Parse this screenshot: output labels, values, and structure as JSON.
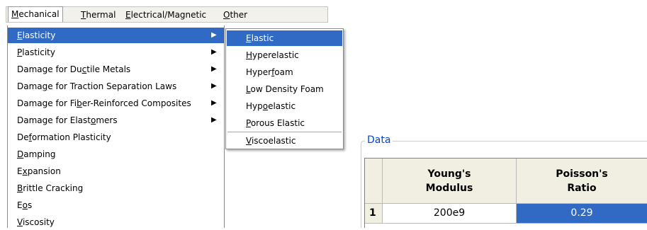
{
  "menubar": {
    "items": [
      {
        "pre": "",
        "u": "M",
        "post": "echanical"
      },
      {
        "pre": "",
        "u": "T",
        "post": "hermal"
      },
      {
        "pre": "",
        "u": "E",
        "post": "lectrical/Magnetic"
      },
      {
        "pre": "",
        "u": "O",
        "post": "ther"
      }
    ]
  },
  "mechanical_menu": {
    "items": [
      {
        "pre": "",
        "u": "E",
        "post": "lasticity"
      },
      {
        "pre": "",
        "u": "P",
        "post": "lasticity"
      },
      {
        "pre": "Damage for Du",
        "u": "c",
        "post": "tile Metals"
      },
      {
        "pre": "Dama",
        "u": "g",
        "post": "e for Traction Separation Laws"
      },
      {
        "pre": "Damage for Fi",
        "u": "b",
        "post": "er-Reinforced Composites"
      },
      {
        "pre": "Damage for Elast",
        "u": "o",
        "post": "mers"
      },
      {
        "pre": "De",
        "u": "f",
        "post": "ormation Plasticity"
      },
      {
        "pre": "",
        "u": "D",
        "post": "amping"
      },
      {
        "pre": "E",
        "u": "x",
        "post": "pansion"
      },
      {
        "pre": "",
        "u": "B",
        "post": "rittle Cracking"
      },
      {
        "pre": "E",
        "u": "o",
        "post": "s"
      },
      {
        "pre": "",
        "u": "V",
        "post": "iscosity"
      }
    ],
    "arrow": "▶"
  },
  "elasticity_submenu": {
    "items": [
      {
        "pre": "",
        "u": "E",
        "post": "lastic"
      },
      {
        "pre": "",
        "u": "H",
        "post": "yperelastic"
      },
      {
        "pre": "Hyper",
        "u": "f",
        "post": "oam"
      },
      {
        "pre": "",
        "u": "L",
        "post": "ow Density Foam"
      },
      {
        "pre": "Hyp",
        "u": "o",
        "post": "elastic"
      },
      {
        "pre": "",
        "u": "P",
        "post": "orous Elastic"
      },
      {
        "pre": "",
        "u": "V",
        "post": "iscoelastic"
      }
    ]
  },
  "data_group": {
    "title": "Data",
    "columns": [
      {
        "line1": "Young's",
        "line2": "Modulus"
      },
      {
        "line1": "Poisson's",
        "line2": "Ratio"
      }
    ],
    "rows": [
      {
        "index": "1",
        "values": [
          "200e9",
          "0.29"
        ]
      }
    ]
  },
  "colors": {
    "selection": "#316ac5",
    "group_title": "#0046d5",
    "header_bg": "#f1efe2"
  }
}
